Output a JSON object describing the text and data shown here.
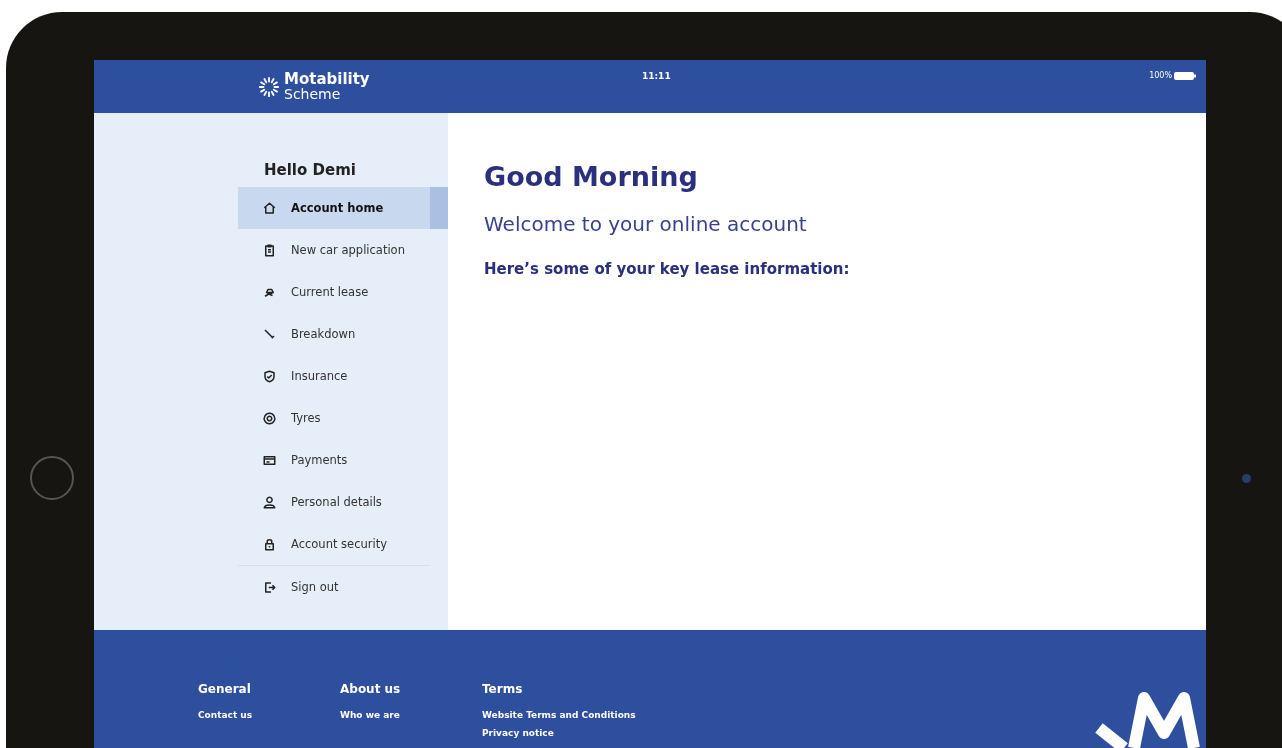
{
  "status_bar": {
    "time": "11:11",
    "battery": "100%"
  },
  "logo": {
    "line1": "Motability",
    "line2": "Scheme"
  },
  "sidebar": {
    "greeting": "Hello Demi",
    "items": [
      {
        "label": "Account home",
        "selected": true
      },
      {
        "label": "New car application",
        "selected": false
      },
      {
        "label": "Current lease",
        "selected": false
      },
      {
        "label": "Breakdown",
        "selected": false
      },
      {
        "label": "Insurance",
        "selected": false
      },
      {
        "label": "Tyres",
        "selected": false
      },
      {
        "label": "Payments",
        "selected": false
      },
      {
        "label": "Personal details",
        "selected": false
      },
      {
        "label": "Account security",
        "selected": false
      }
    ],
    "sign_out": "Sign out"
  },
  "main": {
    "title": "Good Morning",
    "subtitle": "Welcome to your online account",
    "intro": "Here’s some of your key lease information:"
  },
  "footer": {
    "columns": [
      {
        "heading": "General",
        "links": [
          "Contact us"
        ]
      },
      {
        "heading": "About us",
        "links": [
          "Who we are"
        ]
      },
      {
        "heading": "Terms",
        "links": [
          "Website Terms and Conditions",
          "Privacy notice"
        ]
      }
    ]
  }
}
